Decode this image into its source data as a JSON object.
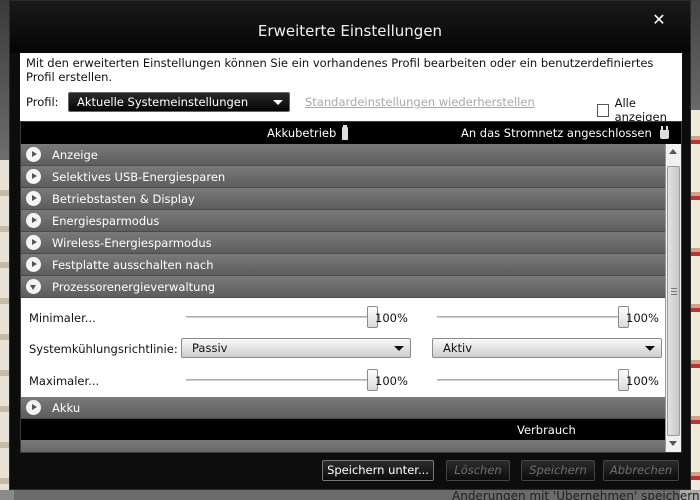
{
  "window": {
    "title": "Erweiterte Einstellungen"
  },
  "description": "Mit den erweiterten Einstellungen können Sie ein vorhandenes Profil bearbeiten oder ein benutzerdefiniertes Profil erstellen.",
  "profile": {
    "label": "Profil:",
    "selected": "Aktuelle Systemeinstellungen",
    "restore_link": "Standardeinstellungen wiederherstellen",
    "show_all": "Alle anzeigen",
    "show_all_checked": false
  },
  "columns": {
    "battery": "Akkubetrieb",
    "plugged": "An das Stromnetz angeschlossen"
  },
  "categories_top": [
    "Anzeige",
    "Selektives USB-Energiesparen",
    "Betriebstasten & Display",
    "Energiesparmodus",
    "Wireless-Energiesparmodus",
    "Festplatte ausschalten nach"
  ],
  "expanded_category": "Prozessorenergieverwaltung",
  "settings": {
    "minimal": {
      "label": "Minimaler...",
      "battery": "100%",
      "plugged": "100%",
      "battery_level": 1.0,
      "plugged_level": 1.0
    },
    "cooling": {
      "label": "Systemkühlungsrichtlinie:",
      "battery": "Passiv",
      "plugged": "Aktiv"
    },
    "maximal": {
      "label": "Maximaler...",
      "battery": "100%",
      "plugged": "100%",
      "battery_level": 1.0,
      "plugged_level": 1.0
    }
  },
  "category_after": "Akku",
  "sub_header": "Verbrauch",
  "buttons": {
    "save_as": "Speichern unter...",
    "delete": "Löschen",
    "save": "Speichern",
    "cancel": "Abbrechen"
  },
  "background_text": "Änderungen mit 'Übernehmen' speichern"
}
